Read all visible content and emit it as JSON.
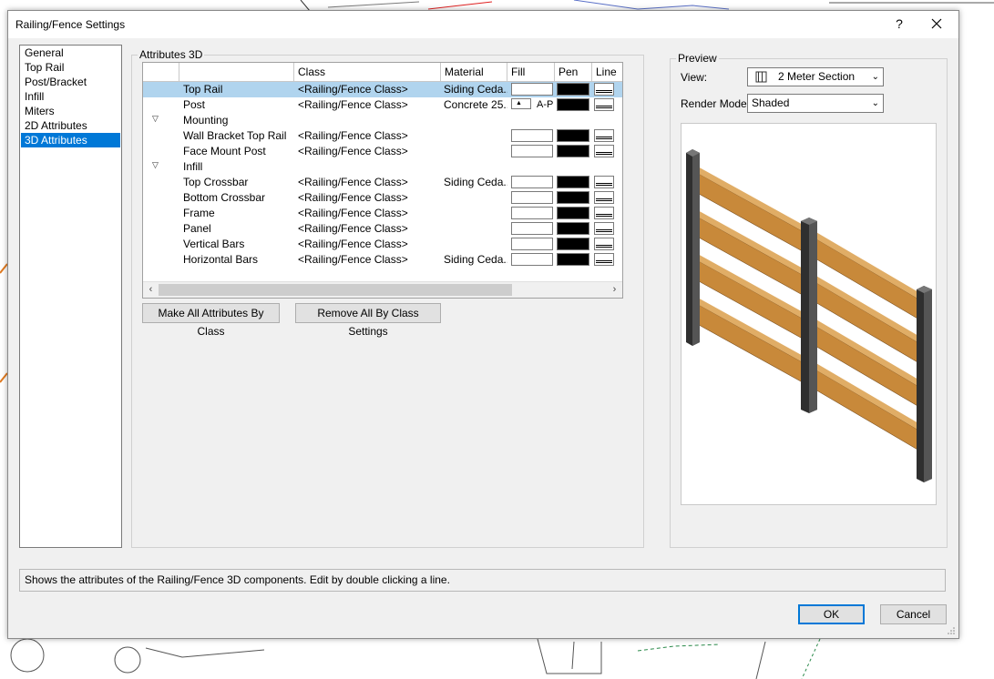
{
  "window": {
    "title": "Railing/Fence Settings",
    "help_label": "?"
  },
  "nav": {
    "items": [
      {
        "label": "General",
        "selected": false
      },
      {
        "label": "Top Rail",
        "selected": false
      },
      {
        "label": "Post/Bracket",
        "selected": false
      },
      {
        "label": "Infill",
        "selected": false
      },
      {
        "label": "Miters",
        "selected": false
      },
      {
        "label": "2D Attributes",
        "selected": false
      },
      {
        "label": "3D Attributes",
        "selected": true
      }
    ]
  },
  "attributes": {
    "group_label": "Attributes 3D",
    "columns": [
      "",
      "",
      "Class",
      "Material",
      "Fill",
      "Pen",
      "Line"
    ],
    "rows": [
      {
        "kind": "item",
        "name": "Top Rail",
        "class": "<Railing/Fence Class>",
        "material": "Siding Ceda...",
        "fill": "white",
        "pen": "black",
        "line": true,
        "selected": true
      },
      {
        "kind": "item",
        "name": "Post",
        "class": "<Railing/Fence Class>",
        "material": "Concrete 25...",
        "fill": "pattern",
        "fill_text": "A-P",
        "pen": "black",
        "line": true
      },
      {
        "kind": "group",
        "name": "Mounting"
      },
      {
        "kind": "item",
        "name": "Wall Bracket Top Rail",
        "class": "<Railing/Fence Class>",
        "material": "",
        "fill": "white",
        "pen": "black",
        "line": true
      },
      {
        "kind": "item",
        "name": "Face Mount Post",
        "class": "<Railing/Fence Class>",
        "material": "",
        "fill": "white",
        "pen": "black",
        "line": true
      },
      {
        "kind": "group",
        "name": "Infill"
      },
      {
        "kind": "item",
        "name": "Top Crossbar",
        "class": "<Railing/Fence Class>",
        "material": "Siding Ceda...",
        "fill": "white",
        "pen": "black",
        "line": true
      },
      {
        "kind": "item",
        "name": "Bottom Crossbar",
        "class": "<Railing/Fence Class>",
        "material": "",
        "fill": "white",
        "pen": "black",
        "line": true
      },
      {
        "kind": "item",
        "name": "Frame",
        "class": "<Railing/Fence Class>",
        "material": "",
        "fill": "white",
        "pen": "black",
        "line": true
      },
      {
        "kind": "item",
        "name": "Panel",
        "class": "<Railing/Fence Class>",
        "material": "",
        "fill": "white",
        "pen": "black",
        "line": true
      },
      {
        "kind": "item",
        "name": "Vertical Bars",
        "class": "<Railing/Fence Class>",
        "material": "",
        "fill": "white",
        "pen": "black",
        "line": true
      },
      {
        "kind": "item",
        "name": "Horizontal Bars",
        "class": "<Railing/Fence Class>",
        "material": "Siding Ceda...",
        "fill": "white",
        "pen": "black",
        "line": true
      }
    ],
    "make_all_label": "Make All Attributes By Class",
    "remove_all_label": "Remove All By Class Settings"
  },
  "preview": {
    "group_label": "Preview",
    "view_label": "View:",
    "view_value": "2 Meter Section",
    "render_label": "Render Mode:",
    "render_value": "Shaded"
  },
  "status_text": "Shows the attributes of the Railing/Fence 3D components. Edit by double clicking a line.",
  "buttons": {
    "ok": "OK",
    "cancel": "Cancel"
  },
  "colors": {
    "selection": "#0078d7",
    "row_selected": "#b0d4ee",
    "wood": "#c8893a",
    "post": "#3a3a3a"
  }
}
